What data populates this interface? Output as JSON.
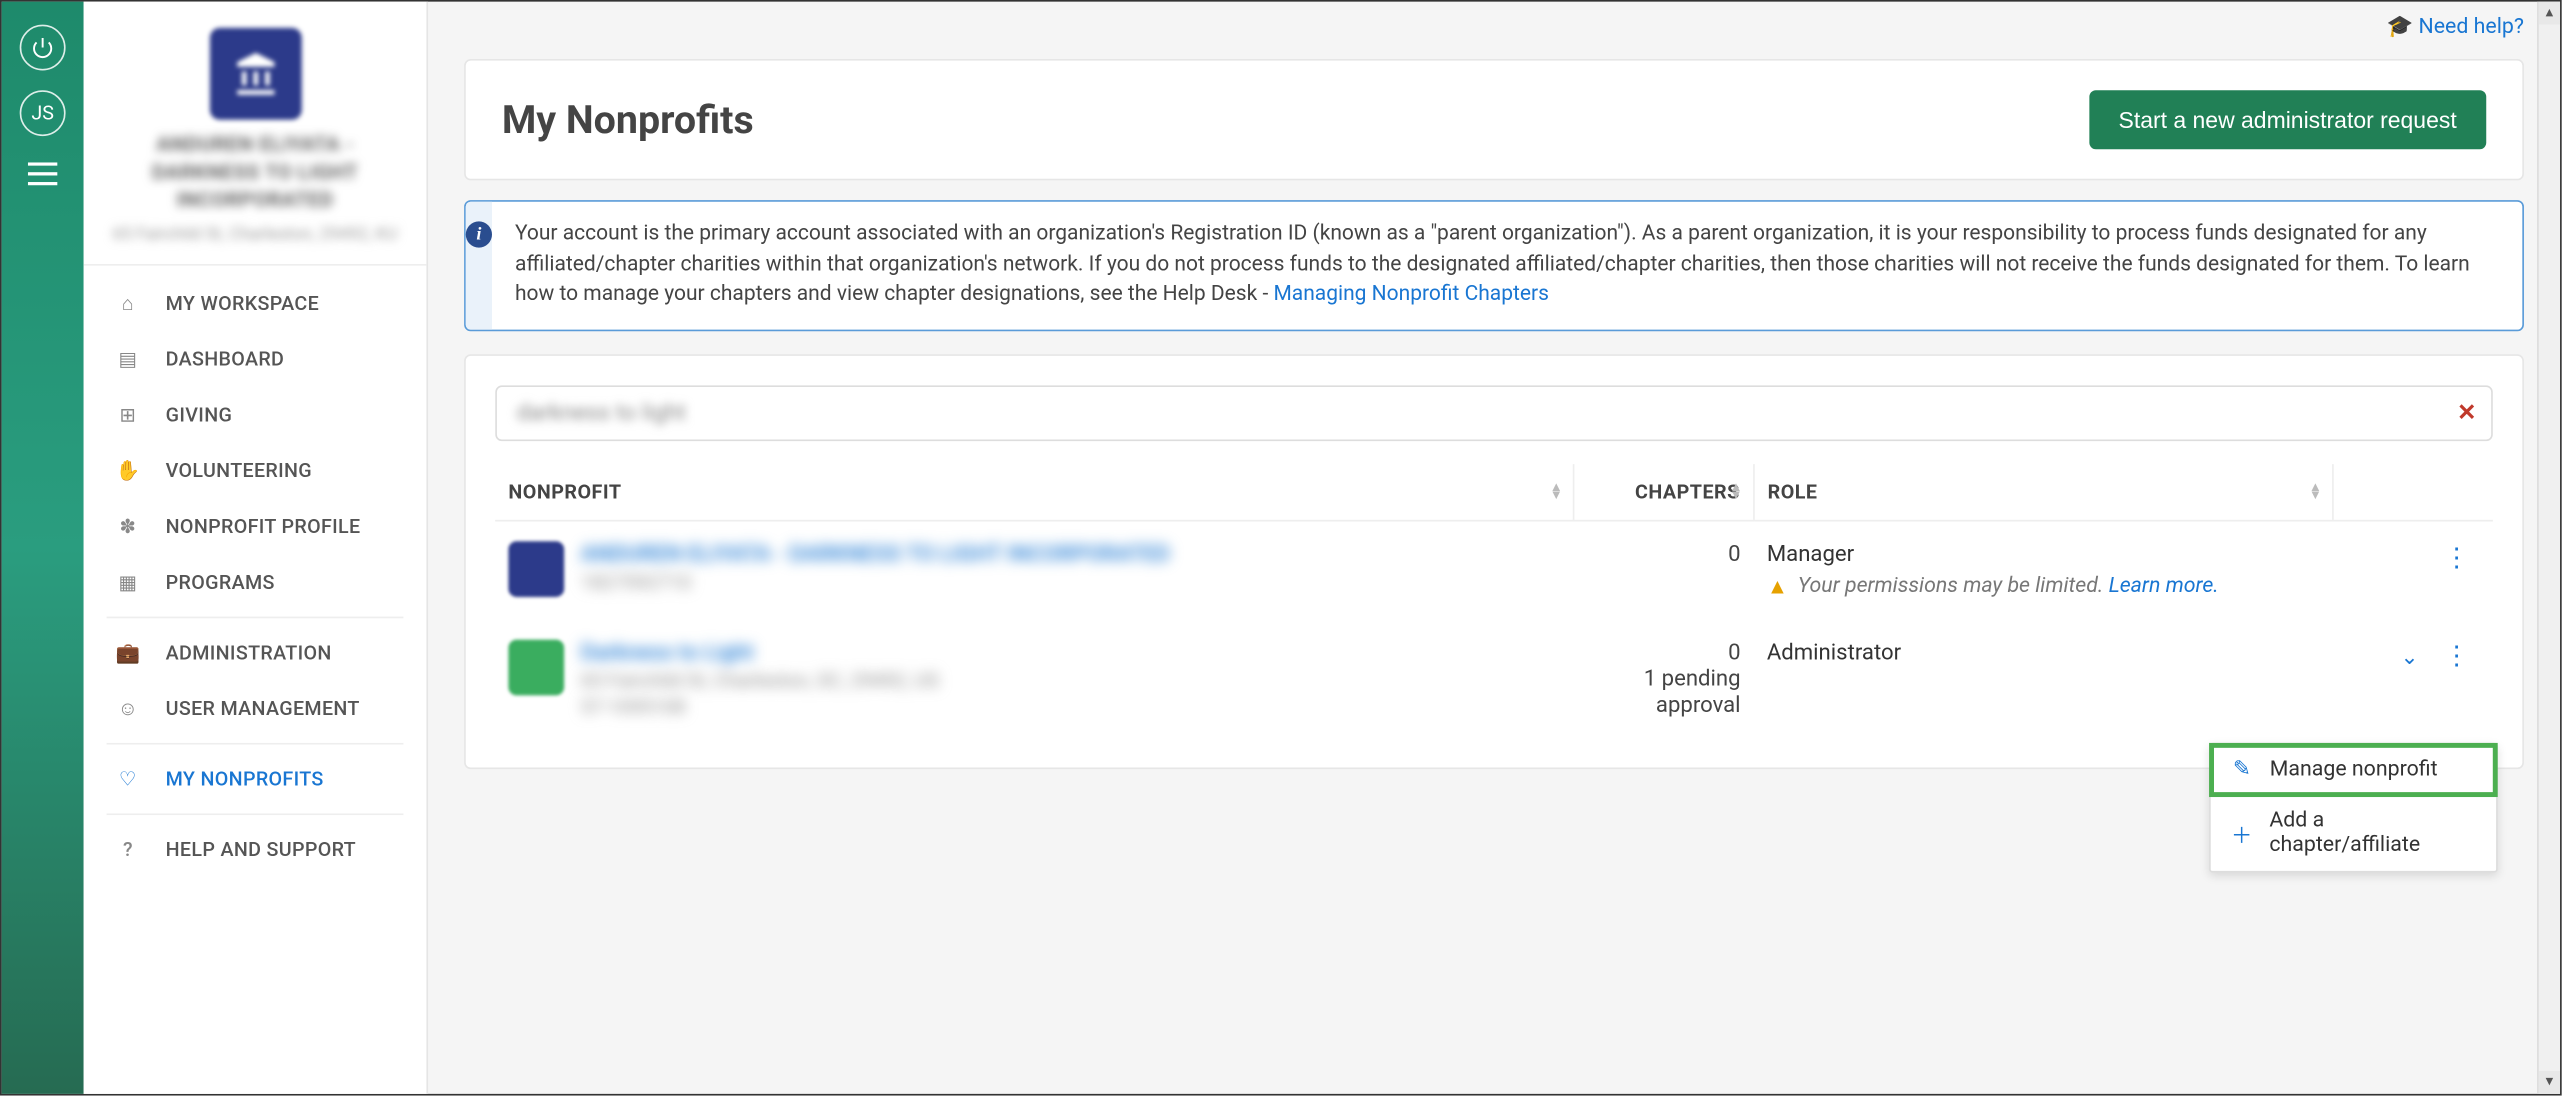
{
  "rail": {
    "user_initials": "JS"
  },
  "org": {
    "name": "ANDUREN ELIYATA - DARKNESS TO LIGHT INCORPORATED",
    "address": "65 Fairchild St, Charleston, 29492, KU"
  },
  "nav": {
    "my_workspace": "MY WORKSPACE",
    "dashboard": "DASHBOARD",
    "giving": "GIVING",
    "volunteering": "VOLUNTEERING",
    "nonprofit_profile": "NONPROFIT PROFILE",
    "programs": "PROGRAMS",
    "administration": "ADMINISTRATION",
    "user_management": "USER MANAGEMENT",
    "my_nonprofits": "MY NONPROFITS",
    "help_support": "HELP AND SUPPORT"
  },
  "help_link": "Need help?",
  "page_title": "My Nonprofits",
  "primary_button": "Start a new administrator request",
  "alert": {
    "text_a": "Your account is the primary account associated with an organization's Registration ID (known as a \"parent organization\"). As a parent organization, it is your responsibility to process funds designated for any affiliated/chapter charities within that organization's network. If you do not process funds to the designated affiliated/chapter charities, then those charities will not receive the funds designated for them. To learn how to manage your chapters and view chapter designations, see the Help Desk - ",
    "link": "Managing Nonprofit Chapters"
  },
  "search_value": "darkness to light",
  "columns": {
    "nonprofit": "NONPROFIT",
    "chapters": "CHAPTERS",
    "role": "ROLE"
  },
  "rows": [
    {
      "name": "ANDUREN ELIYATA - DARKNESS TO LIGHT INCORPORATED",
      "sub1": "1827592710",
      "chapters": "0",
      "role": "Manager",
      "warn_text": "Your permissions may be limited.",
      "warn_link": "Learn more."
    },
    {
      "name": "Darkness to Light",
      "sub1": "65 Fairchild St, Charleston, SC, 29492, US",
      "sub2": "57-1095108",
      "chapters": "0",
      "pending": "1 pending approval",
      "role": "Administrator"
    }
  ],
  "dropdown": {
    "manage": "Manage nonprofit",
    "add_chapter": "Add a chapter/affiliate"
  }
}
